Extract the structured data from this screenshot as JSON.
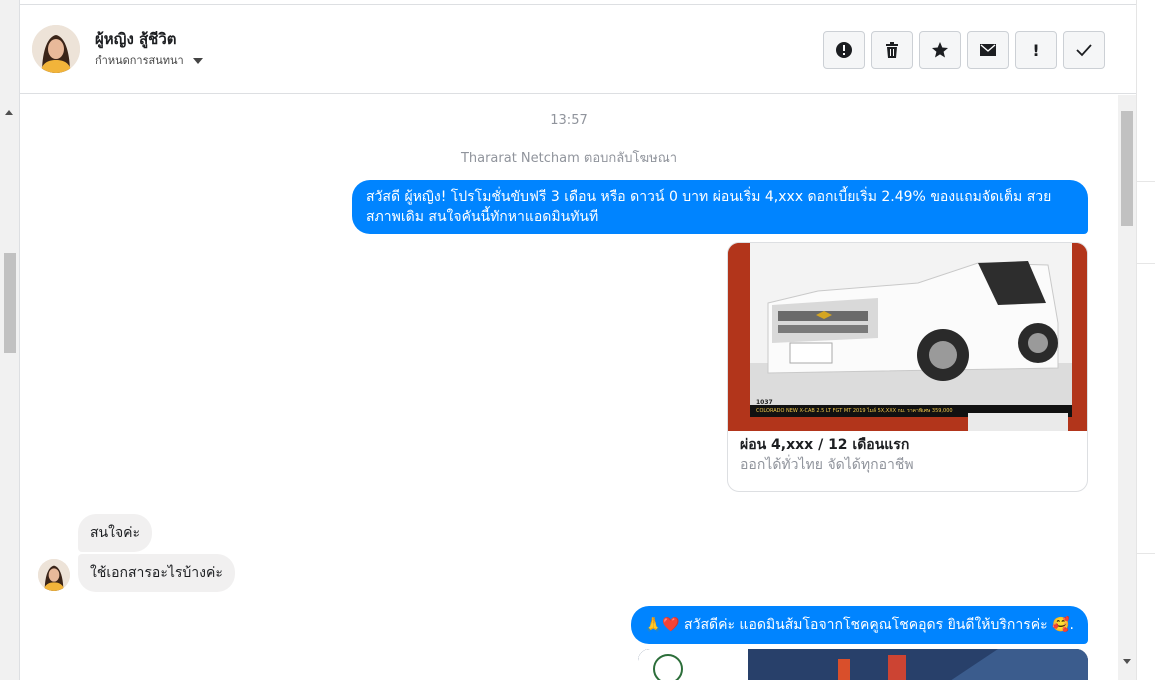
{
  "header": {
    "user_name": "ผู้หญิง สู้ชีวิต",
    "subtitle": "กำหนดการสนทนา"
  },
  "toolbar": {
    "buttons": [
      "report-icon",
      "trash-icon",
      "star-icon",
      "envelope-icon",
      "exclamation-icon",
      "check-icon"
    ],
    "exclamation_label": "!"
  },
  "conversation": {
    "timestamp": "13:57",
    "reply_note": "Thararat Netcham ตอบกลับโฆษณา",
    "outgoing_1": "สวัสดี ผู้หญิง! โปรโมชั่นขับฟรี 3 เดือน หรือ ดาวน์ 0 บาท ผ่อนเริ่ม 4,xxx ดอกเบี้ยเริ่ม 2.49% ของแถมจัดเต็ม สวยสภาพเดิม สนใจคันนี้ทักหาแอดมินทันที",
    "card": {
      "title": "ผ่อน 4,xxx / 12 เดือนแรก",
      "subtitle": "ออกได้ทั่วไทย จัดได้ทุกอาชีพ",
      "image_caption": "COLORADO NEW X-CAB 2.5 LT FGT MT 2019 ไมล์ 5X,XXX กม. ราคาพิเศษ 359,000",
      "image_code": "1037"
    },
    "incoming_1": "สนใจค่ะ",
    "incoming_2": "ใช้เอกสารอะไรบ้างค่ะ",
    "outgoing_2": "🙏❤️ สวัสดีค่ะ แอดมินส้มโอจากโชคคูณโชคอุดร ยินดีให้บริการค่ะ 🥰."
  },
  "colors": {
    "outgoing_bubble": "#0084ff",
    "incoming_bubble": "#f1f0f0",
    "border": "#dddfe2"
  }
}
